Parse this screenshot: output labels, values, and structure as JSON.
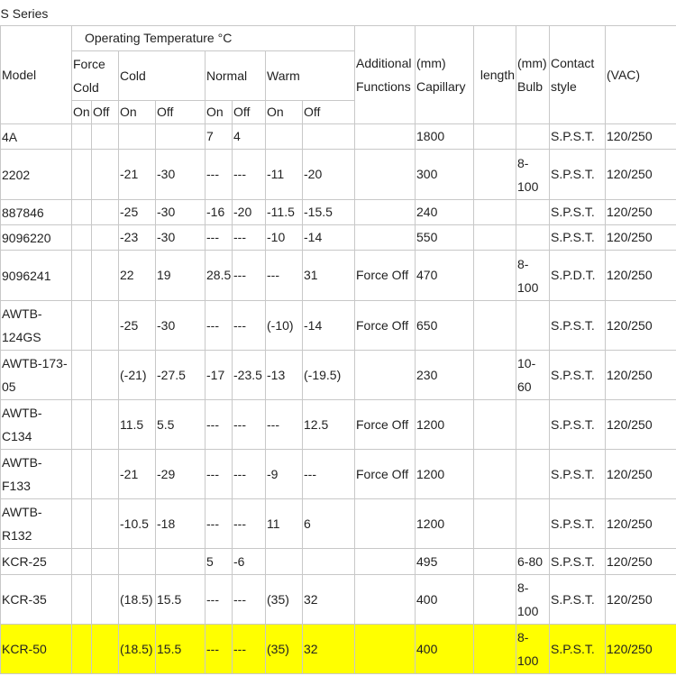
{
  "title": "S Series",
  "headers": {
    "model": "Model",
    "operating_temp": "Operating Temperature °C",
    "force_cold": "Force Cold",
    "cold": "Cold",
    "normal": "Normal",
    "warm": "Warm",
    "additional_functions": "Additional Functions",
    "capillary": "(mm) Capillary",
    "length": "length",
    "bulb": "(mm) Bulb",
    "contact_style": "Contact style",
    "vac": "(VAC)",
    "on": "On",
    "off": "Off"
  },
  "rows": [
    {
      "model": "4A",
      "fc_on": "",
      "fc_off": "",
      "cold_on": "",
      "cold_off": "",
      "normal_on": "7",
      "normal_off": "4",
      "warm_on": "",
      "warm_off": "",
      "additional": "",
      "capillary": "1800",
      "length": "",
      "bulb": "",
      "contact": "S.P.S.T.",
      "vac": "120/250"
    },
    {
      "model": "2202",
      "fc_on": "",
      "fc_off": "",
      "cold_on": "-21",
      "cold_off": "-30",
      "normal_on": "---",
      "normal_off": "---",
      "warm_on": "-11",
      "warm_off": "-20",
      "additional": "",
      "capillary": "300",
      "length": "",
      "bulb": "8-100",
      "contact": "S.P.S.T.",
      "vac": "120/250"
    },
    {
      "model": "887846",
      "fc_on": "",
      "fc_off": "",
      "cold_on": "-25",
      "cold_off": "-30",
      "normal_on": "-16",
      "normal_off": "-20",
      "warm_on": "-11.5",
      "warm_off": "-15.5",
      "additional": "",
      "capillary": "240",
      "length": "",
      "bulb": "",
      "contact": "S.P.S.T.",
      "vac": "120/250"
    },
    {
      "model": "9096220",
      "fc_on": "",
      "fc_off": "",
      "cold_on": "-23",
      "cold_off": "-30",
      "normal_on": "---",
      "normal_off": "---",
      "warm_on": "-10",
      "warm_off": "-14",
      "additional": "",
      "capillary": "550",
      "length": "",
      "bulb": "",
      "contact": "S.P.S.T.",
      "vac": "120/250"
    },
    {
      "model": "9096241",
      "fc_on": "",
      "fc_off": "",
      "cold_on": "22",
      "cold_off": "19",
      "normal_on": "28.5",
      "normal_off": "---",
      "warm_on": "---",
      "warm_off": "31",
      "additional": "Force Off",
      "capillary": "470",
      "length": "",
      "bulb": "8-100",
      "contact": "S.P.D.T.",
      "vac": "120/250"
    },
    {
      "model": "AWTB-124GS",
      "fc_on": "",
      "fc_off": "",
      "cold_on": "-25",
      "cold_off": "-30",
      "normal_on": "---",
      "normal_off": "---",
      "warm_on": "(-10)",
      "warm_off": "-14",
      "additional": "Force Off",
      "capillary": "650",
      "length": "",
      "bulb": "",
      "contact": "S.P.S.T.",
      "vac": "120/250"
    },
    {
      "model": "AWTB-173-05",
      "fc_on": "",
      "fc_off": "",
      "cold_on": "(-21)",
      "cold_off": "-27.5",
      "normal_on": "-17",
      "normal_off": "-23.5",
      "warm_on": "-13",
      "warm_off": "(-19.5)",
      "additional": "",
      "capillary": "230",
      "length": "",
      "bulb": "10-60",
      "contact": "S.P.S.T.",
      "vac": "120/250"
    },
    {
      "model": "AWTB-C134",
      "fc_on": "",
      "fc_off": "",
      "cold_on": "11.5",
      "cold_off": "5.5",
      "normal_on": "---",
      "normal_off": "---",
      "warm_on": "---",
      "warm_off": "12.5",
      "additional": "Force Off",
      "capillary": "1200",
      "length": "",
      "bulb": "",
      "contact": "S.P.S.T.",
      "vac": "120/250"
    },
    {
      "model": "AWTB-F133",
      "fc_on": "",
      "fc_off": "",
      "cold_on": "-21",
      "cold_off": "-29",
      "normal_on": "---",
      "normal_off": "---",
      "warm_on": "-9",
      "warm_off": "---",
      "additional": "Force Off",
      "capillary": "1200",
      "length": "",
      "bulb": "",
      "contact": "S.P.S.T.",
      "vac": "120/250"
    },
    {
      "model": "AWTB-R132",
      "fc_on": "",
      "fc_off": "",
      "cold_on": "-10.5",
      "cold_off": "-18",
      "normal_on": "---",
      "normal_off": "---",
      "warm_on": "11",
      "warm_off": "6",
      "additional": "",
      "capillary": "1200",
      "length": "",
      "bulb": "",
      "contact": "S.P.S.T.",
      "vac": "120/250"
    },
    {
      "model": "KCR-25",
      "fc_on": "",
      "fc_off": "",
      "cold_on": "",
      "cold_off": "",
      "normal_on": "5",
      "normal_off": "-6",
      "warm_on": "",
      "warm_off": "",
      "additional": "",
      "capillary": "495",
      "length": "",
      "bulb": "6-80",
      "contact": "S.P.S.T.",
      "vac": "120/250"
    },
    {
      "model": "KCR-35",
      "fc_on": "",
      "fc_off": "",
      "cold_on": "(18.5)",
      "cold_off": "15.5",
      "normal_on": "---",
      "normal_off": "---",
      "warm_on": "(35)",
      "warm_off": "32",
      "additional": "",
      "capillary": "400",
      "length": "",
      "bulb": "8-100",
      "contact": "S.P.S.T.",
      "vac": "120/250"
    },
    {
      "model": "KCR-50",
      "fc_on": "",
      "fc_off": "",
      "cold_on": "(18.5)",
      "cold_off": "15.5",
      "normal_on": "---",
      "normal_off": "---",
      "warm_on": "(35)",
      "warm_off": "32",
      "additional": "",
      "capillary": "400",
      "length": "",
      "bulb": "8-100",
      "contact": "S.P.S.T.",
      "vac": "120/250",
      "highlighted": true
    }
  ],
  "highlight_color": "#ffff00"
}
